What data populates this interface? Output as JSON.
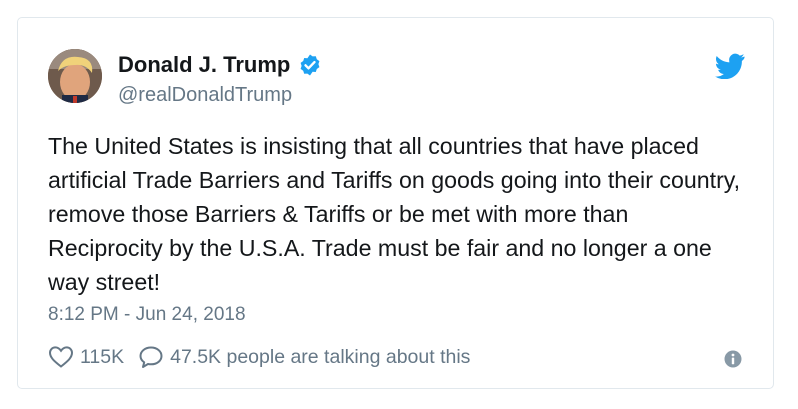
{
  "author": {
    "display_name": "Donald J. Trump",
    "handle": "@realDonaldTrump",
    "verified": true
  },
  "tweet": {
    "text": "The United States is insisting that all countries that have placed artificial Trade Barriers and Tariffs on goods going into their country, remove those Barriers & Tariffs or be met with more than Reciprocity by the U.S.A. Trade must be fair and no longer a one way street!",
    "timestamp": "8:12 PM - Jun 24, 2018"
  },
  "stats": {
    "likes": "115K",
    "talking": "47.5K people are talking about this"
  },
  "icons": {
    "brand": "twitter-bird-icon",
    "verified": "verified-badge-icon",
    "like": "heart-icon",
    "reply": "speech-bubble-icon",
    "info": "info-icon"
  },
  "colors": {
    "brand_blue": "#1da1f2",
    "text_primary": "#14171a",
    "text_secondary": "#657786",
    "border": "#e1e8ed"
  }
}
